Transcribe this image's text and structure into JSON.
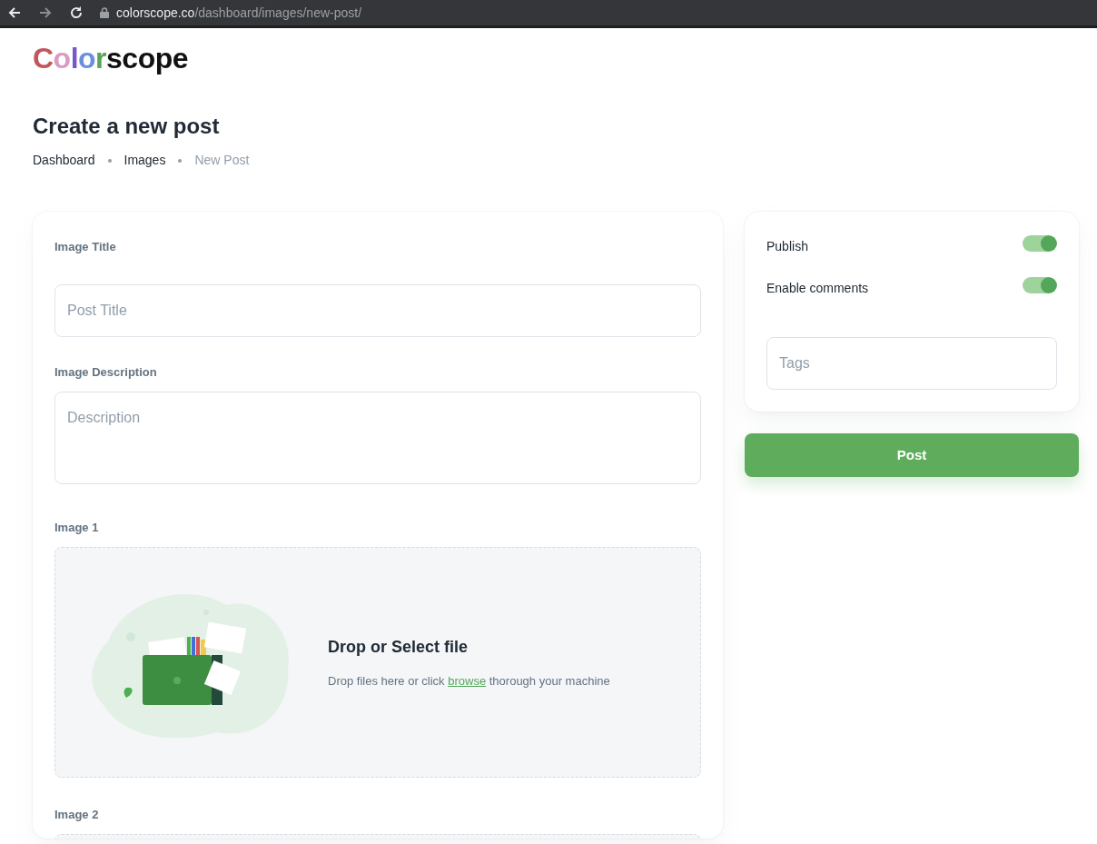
{
  "browser": {
    "url_host": "colorscope.co",
    "url_path": "/dashboard/images/new-post/"
  },
  "logo": {
    "parts": [
      {
        "text": "C",
        "color": "#c0575b"
      },
      {
        "text": "o",
        "color": "#d99bc0"
      },
      {
        "text": "l",
        "color": "#7a57c9"
      },
      {
        "text": "o",
        "color": "#6b8fde"
      },
      {
        "text": "r",
        "color": "#5aa357"
      },
      {
        "text": "scope",
        "color": "#111111"
      }
    ]
  },
  "page_title": "Create a new post",
  "breadcrumb": [
    {
      "label": "Dashboard",
      "current": false
    },
    {
      "label": "Images",
      "current": false
    },
    {
      "label": "New Post",
      "current": true
    }
  ],
  "form": {
    "fields": [
      {
        "kind": "input",
        "label": "Image Title",
        "placeholder": "Post Title"
      },
      {
        "kind": "textarea",
        "label": "Image Description",
        "placeholder": "Description"
      },
      {
        "kind": "dropzone",
        "label": "Image 1",
        "title": "Drop or Select file",
        "text_before": "Drop files here or click",
        "link": "browse",
        "text_after": "thorough your machine"
      },
      {
        "kind": "dropzone_cut",
        "label": "Image 2"
      }
    ]
  },
  "settings": {
    "switches": [
      {
        "label": "Publish",
        "on": true
      },
      {
        "label": "Enable comments",
        "on": true
      }
    ],
    "tags": {
      "placeholder": "Tags"
    }
  },
  "post_button": "Post"
}
